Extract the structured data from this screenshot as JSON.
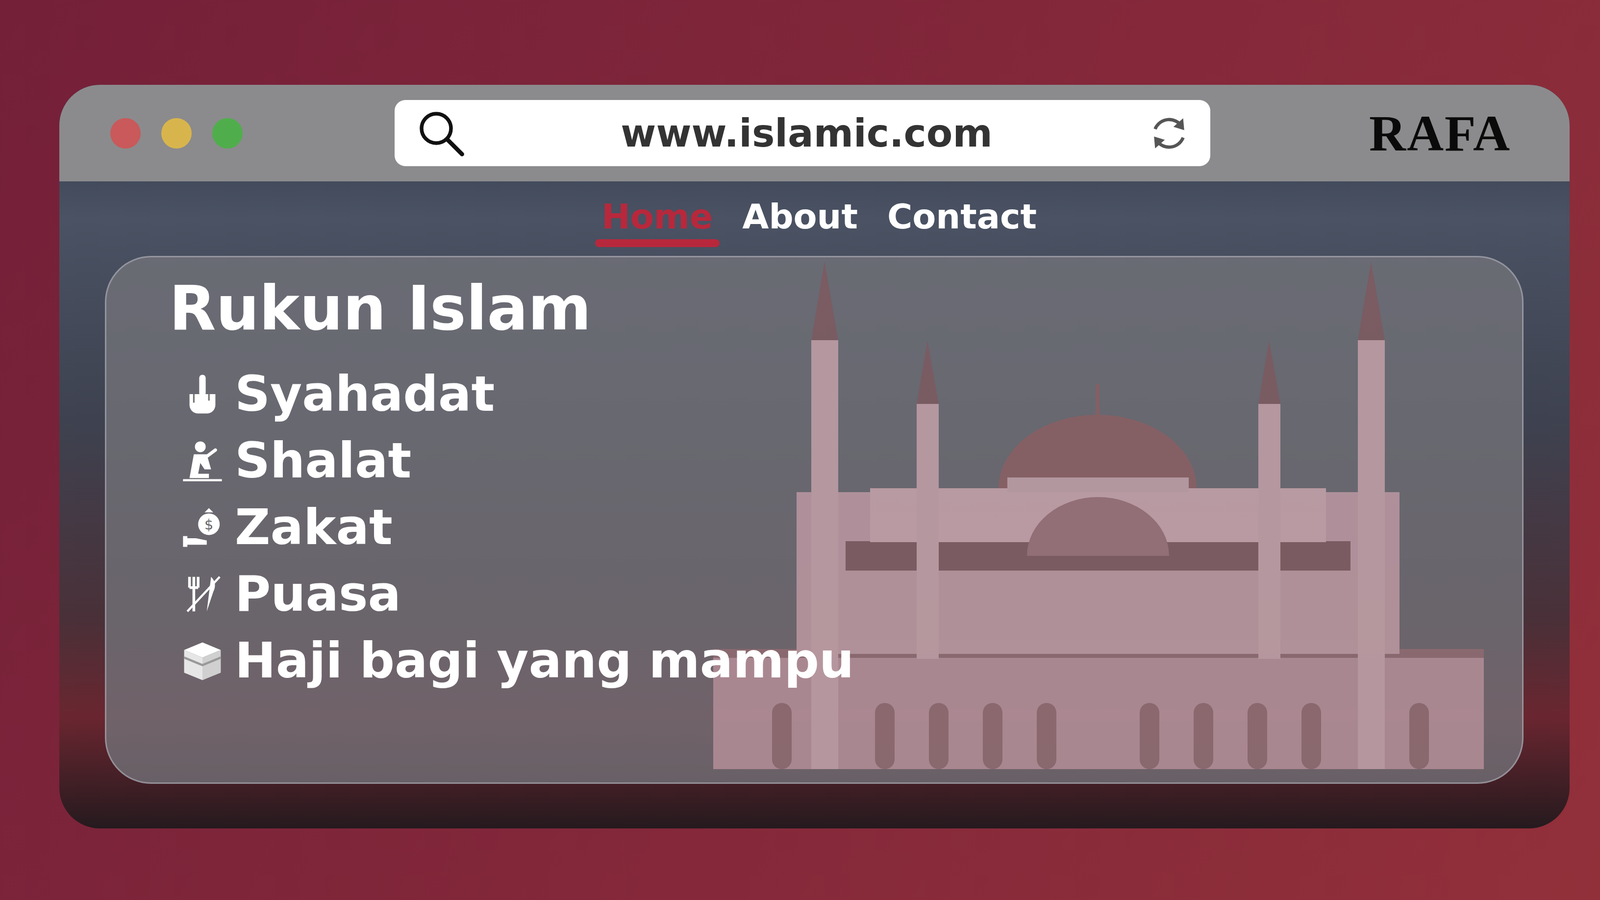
{
  "window": {
    "url": "www.islamic.com",
    "logo": "RAFA"
  },
  "nav": [
    {
      "label": "Home",
      "selected": true
    },
    {
      "label": "About",
      "selected": false
    },
    {
      "label": "Contact",
      "selected": false
    }
  ],
  "card": {
    "title": "Rukun Islam",
    "items": [
      "Syahadat",
      "Shalat",
      "Zakat",
      "Puasa",
      "Haji bagi yang mampu"
    ]
  }
}
